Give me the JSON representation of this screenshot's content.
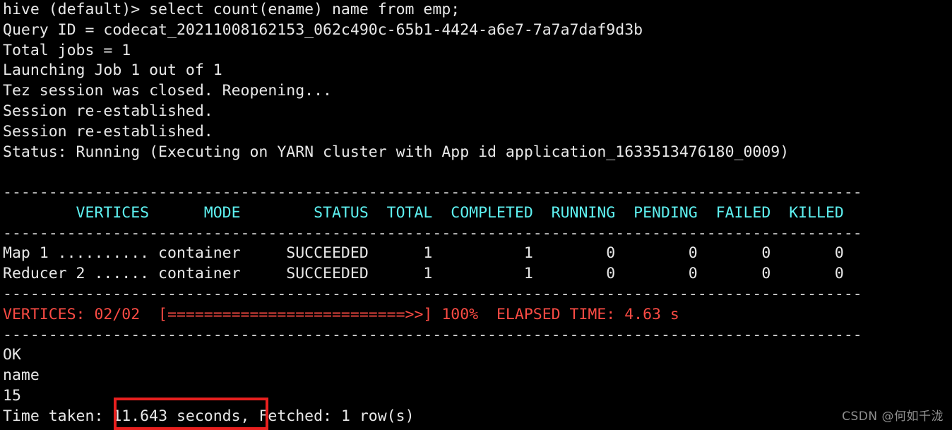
{
  "terminal": {
    "shell_prompt": "hive (default)> ",
    "command": "select count(ename) name from emp;",
    "prompt_line": "hive (default)> select count(ename) name from emp;",
    "query_id_line": "Query ID = codecat_20211008162153_062c490c-65b1-4424-a6e7-7a7a7daf9d3b",
    "total_jobs_line": "Total jobs = 1",
    "launching_line": "Launching Job 1 out of 1",
    "tez_session_line": "Tez session was closed. Reopening...",
    "session_reestablished_line_1": "Session re-established.",
    "session_reestablished_line_2": "Session re-established.",
    "status_line": "Status: Running (Executing on YARN cluster with App id application_1633513476180_0009)",
    "query_id": "codecat_20211008162153_062c490c-65b1-4424-a6e7-7a7a7daf9d3b",
    "app_id": "application_1633513476180_0009",
    "divider_top": "----------------------------------------------------------------------------------------------",
    "divider_under_header": "----------------------------------------------------------------------------------------------",
    "divider_above_vertices": "----------------------------------------------------------------------------------------------",
    "divider_below_vertices": "----------------------------------------------------------------------------------------------",
    "colors": {
      "background": "#000000",
      "foreground": "#e8e8e8",
      "header_cyan": "#5ef1f1",
      "progress_red": "#fb4b44",
      "highlight_box": "#e8201f",
      "watermark": "#8f8f8f"
    }
  },
  "progress_table": {
    "headers_line": "        VERTICES      MODE        STATUS  TOTAL  COMPLETED  RUNNING  PENDING  FAILED  KILLED",
    "headers": [
      "VERTICES",
      "MODE",
      "STATUS",
      "TOTAL",
      "COMPLETED",
      "RUNNING",
      "PENDING",
      "FAILED",
      "KILLED"
    ],
    "rows": [
      {
        "line": "Map 1 .......... container     SUCCEEDED      1          1        0        0       0       0",
        "vertex": "Map 1",
        "dots": "..........",
        "mode": "container",
        "status": "SUCCEEDED",
        "total": "1",
        "completed": "1",
        "running": "0",
        "pending": "0",
        "failed": "0",
        "killed": "0"
      },
      {
        "line": "Reducer 2 ...... container     SUCCEEDED      1          1        0        0       0       0",
        "vertex": "Reducer 2",
        "dots": "......",
        "mode": "container",
        "status": "SUCCEEDED",
        "total": "1",
        "completed": "1",
        "running": "0",
        "pending": "0",
        "failed": "0",
        "killed": "0"
      }
    ]
  },
  "vertices_summary": {
    "line": "VERTICES: 02/02  [==========================>>] 100%  ELAPSED TIME: 4.63 s",
    "label": "VERTICES:",
    "count": "02/02",
    "bar": "[==========================>>]",
    "percent": "100%",
    "elapsed_label": "ELAPSED TIME:",
    "elapsed_value": "4.63 s"
  },
  "results": {
    "ok_line": "OK",
    "column_header_line": "name",
    "value_line": "15",
    "time_taken_prefix": "Time taken: ",
    "time_taken_value": "11.643 seconds,",
    "fetched_suffix": " Fetched: 1 row(s)",
    "time_taken_full_line": "Time taken: 11.643 seconds, Fetched: 1 row(s)"
  },
  "watermark": {
    "text": "CSDN @何如千泷"
  }
}
